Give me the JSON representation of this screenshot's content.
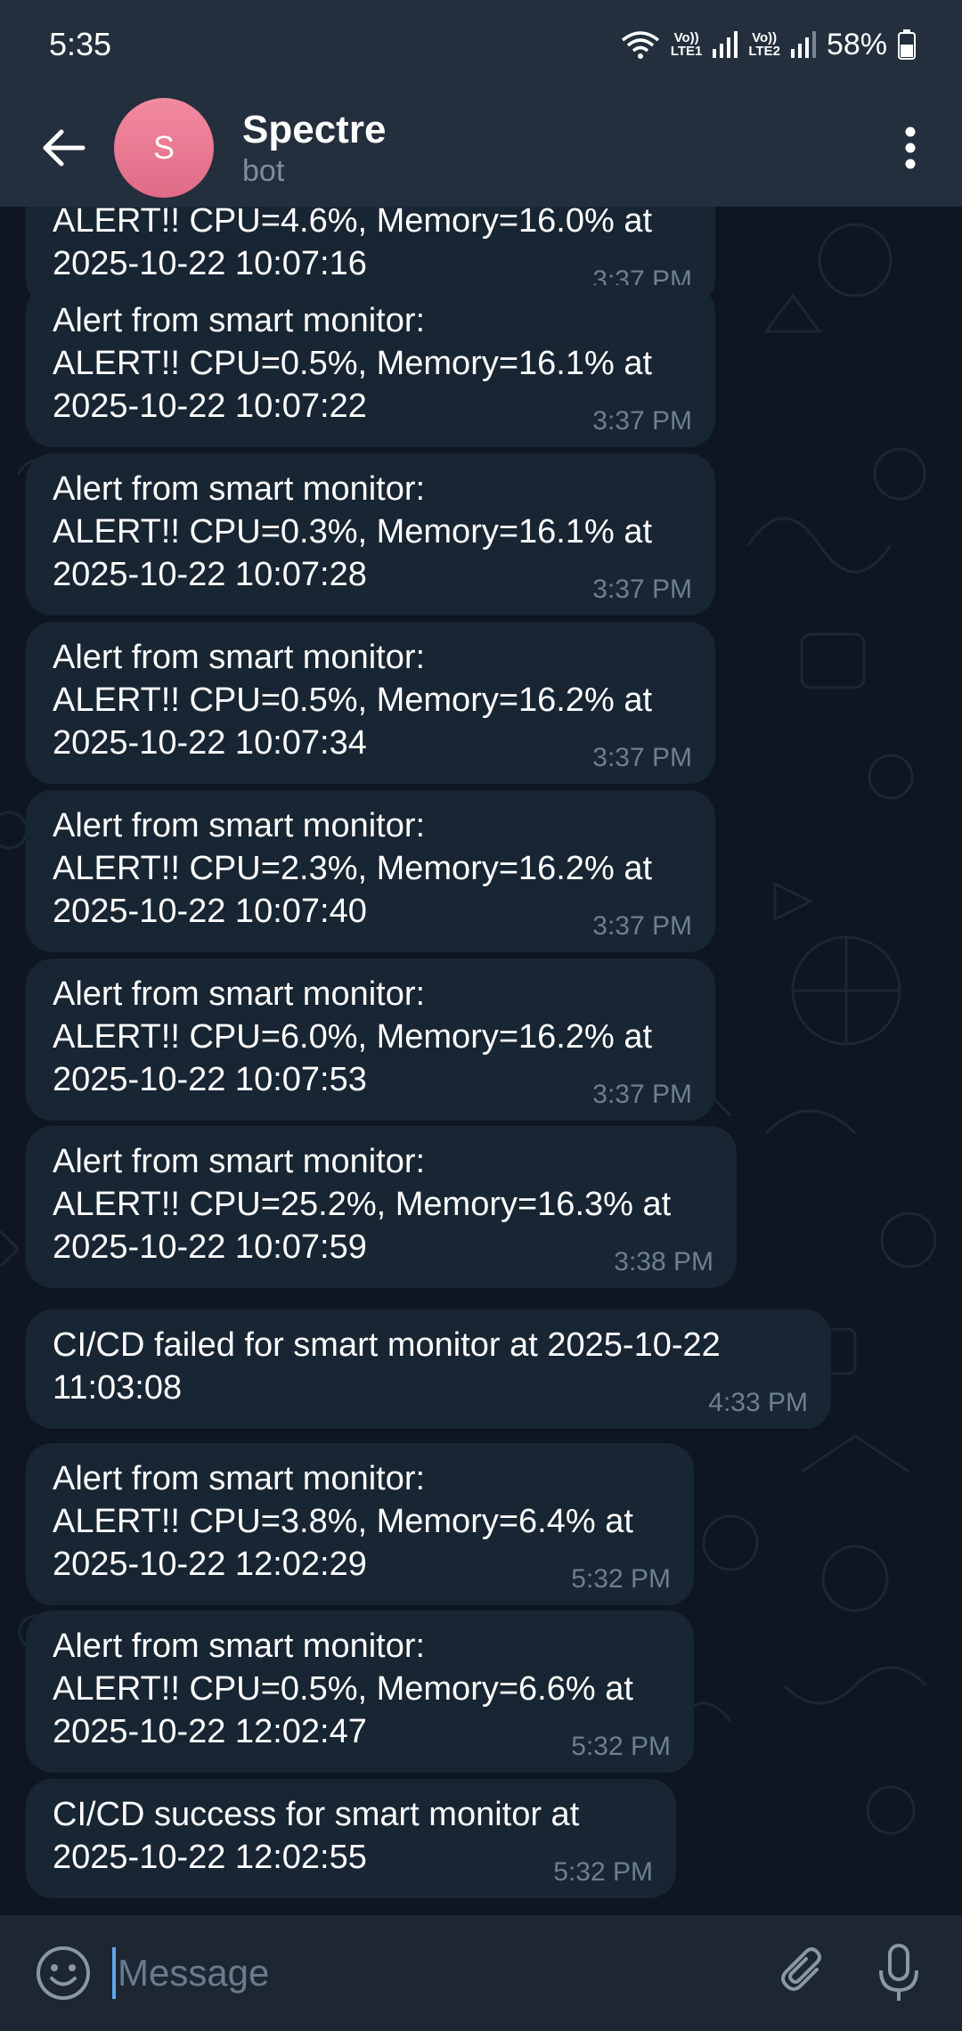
{
  "status_bar": {
    "time": "5:35",
    "sim1_label_top": "Vo))",
    "sim1_label_bottom": "LTE1",
    "sim2_label_top": "Vo))",
    "sim2_label_bottom": "LTE2",
    "battery_percent": "58%",
    "icons": [
      "wifi-icon",
      "signal-icon",
      "battery-icon"
    ]
  },
  "header": {
    "title": "Spectre",
    "subtitle": "bot",
    "avatar_letter": "S",
    "avatar_color": "#e97590"
  },
  "messages": [
    {
      "text": "ALERT!! CPU=4.6%, Memory=16.0% at\n2025-10-22 10:07:16",
      "time": "3:37 PM"
    },
    {
      "text": "Alert from smart monitor:\nALERT!! CPU=0.5%, Memory=16.1% at\n2025-10-22 10:07:22",
      "time": "3:37 PM"
    },
    {
      "text": "Alert from smart monitor:\nALERT!! CPU=0.3%, Memory=16.1% at\n2025-10-22 10:07:28",
      "time": "3:37 PM"
    },
    {
      "text": "Alert from smart monitor:\nALERT!! CPU=0.5%, Memory=16.2% at\n2025-10-22 10:07:34",
      "time": "3:37 PM"
    },
    {
      "text": "Alert from smart monitor:\nALERT!! CPU=2.3%, Memory=16.2% at\n2025-10-22 10:07:40",
      "time": "3:37 PM"
    },
    {
      "text": "Alert from smart monitor:\nALERT!! CPU=6.0%, Memory=16.2% at\n2025-10-22 10:07:53",
      "time": "3:37 PM"
    },
    {
      "text": "Alert from smart monitor:\nALERT!! CPU=25.2%, Memory=16.3% at\n2025-10-22 10:07:59",
      "time": "3:38 PM"
    },
    {
      "text": "CI/CD failed for smart monitor at 2025-10-22\n11:03:08",
      "time": "4:33 PM"
    },
    {
      "text": "Alert from smart monitor:\nALERT!! CPU=3.8%, Memory=6.4% at\n2025-10-22 12:02:29",
      "time": "5:32 PM"
    },
    {
      "text": "Alert from smart monitor:\nALERT!! CPU=0.5%, Memory=6.6% at\n2025-10-22 12:02:47",
      "time": "5:32 PM"
    },
    {
      "text": "CI/CD success for smart monitor at\n2025-10-22 12:02:55",
      "time": "5:32 PM"
    }
  ],
  "composer": {
    "placeholder": "Message"
  },
  "colors": {
    "background": "#0e1621",
    "bubble": "#182533",
    "bar": "#242f3d",
    "accent": "#5ea7e8"
  }
}
